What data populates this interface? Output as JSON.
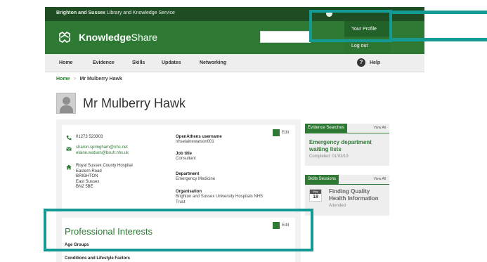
{
  "header": {
    "org_name_bold": "Brighton and Sussex",
    "org_name_rest": " Library and Knowledge Service",
    "brand_bold": "Knowledge",
    "brand_rest": "Share",
    "user_menu": [
      "Your Profile",
      "Log out"
    ]
  },
  "nav": {
    "items": [
      "Home",
      "Evidence",
      "Skills",
      "Updates",
      "Networking"
    ],
    "help": "Help"
  },
  "breadcrumb": {
    "home": "Home",
    "separator": ">",
    "current": "Mr Mulberry Hawk"
  },
  "profile": {
    "name": "Mr Mulberry Hawk",
    "edit_label": "Edit",
    "phone": "01273 523303",
    "emails": [
      "sharon.springham@nhs.net",
      "elaine.watson@bsuh.nhs.uk"
    ],
    "address": [
      "Royal Sussex County Hospital",
      "Eastern Road",
      "BRIGHTON",
      "East Sussex",
      "BN2 5BE"
    ],
    "fields": [
      {
        "label": "OpenAthens username",
        "value": "nhselainewatson001"
      },
      {
        "label": "Job title",
        "value": "Consultant"
      },
      {
        "label": "Department",
        "value": "Emergency Medicine"
      },
      {
        "label": "Organisation",
        "value": "Brighton and Sussex University Hospitals NHS",
        "value2": "Trust"
      }
    ]
  },
  "interests": {
    "title": "Professional Interests",
    "edit_label": "Edit",
    "subheads": [
      "Age Groups",
      "Conditions and Lifestyle Factors"
    ]
  },
  "sidebar": {
    "evidence": {
      "tab": "Evidence Searches",
      "view_all": "View All",
      "item_title": "Emergency department waiting lists",
      "item_meta": "Completed: 01/03/19"
    },
    "skills": {
      "tab": "Skills Sessions",
      "view_all": "View All",
      "date_month": "May",
      "date_day": "18",
      "item_title": "Finding Quality Health Information",
      "item_meta": "Attended"
    }
  },
  "colors": {
    "brand_dark": "#1f4d23",
    "brand": "#2e7a35",
    "highlight": "#149a94"
  },
  "icons": [
    "logo-icon",
    "phone-icon",
    "email-icon",
    "home-icon",
    "edit-icon",
    "help-icon",
    "user-icon"
  ]
}
